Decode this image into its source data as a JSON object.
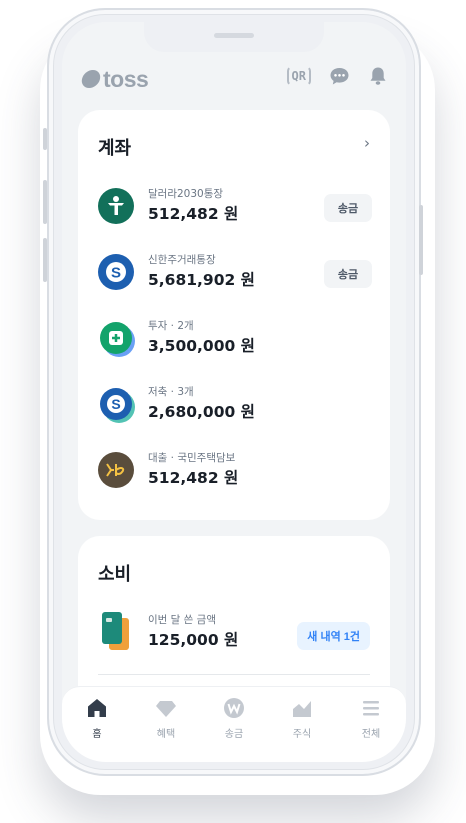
{
  "brand": {
    "name": "toss"
  },
  "header": {
    "qr_label": "QR",
    "icons": [
      "qr-code-icon",
      "chat-bubble-icon",
      "bell-icon"
    ]
  },
  "accounts": {
    "title": "계좌",
    "items": [
      {
        "label": "달러라2030통장",
        "amount": "512,482 원",
        "action": "송금",
        "icon": "bank-person-icon",
        "color": "#12705a"
      },
      {
        "label": "신한주거래통장",
        "amount": "5,681,902 원",
        "action": "송금",
        "icon": "shinhan-s-icon",
        "color": "#1d5fb0"
      },
      {
        "label": "투자 · 2개",
        "amount": "3,500,000 원",
        "action": "",
        "icon": "investment-stack-icon",
        "color": "#13a36b"
      },
      {
        "label": "저축 · 3개",
        "amount": "2,680,000 원",
        "action": "",
        "icon": "savings-stack-icon",
        "color": "#1d5fb0"
      },
      {
        "label": "대출 · 국민주택담보",
        "amount": "512,482 원",
        "action": "",
        "icon": "kb-loan-icon",
        "color": "#5a4d3c"
      }
    ]
  },
  "spending": {
    "title": "소비",
    "label": "이번 달 쓴 금액",
    "amount": "125,000 원",
    "action": "새 내역 1건",
    "icon": "cards-icon"
  },
  "tabs": [
    {
      "label": "홈",
      "icon": "home-icon",
      "active": true
    },
    {
      "label": "혜택",
      "icon": "gem-icon",
      "active": false
    },
    {
      "label": "송금",
      "icon": "won-coin-icon",
      "active": false
    },
    {
      "label": "주식",
      "icon": "stock-chart-icon",
      "active": false
    },
    {
      "label": "전체",
      "icon": "menu-lines-icon",
      "active": false
    }
  ],
  "colors": {
    "background": "#f2f4f6",
    "card": "#ffffff",
    "text_primary": "#191f28",
    "text_secondary": "#6b7684",
    "accent": "#3182f6",
    "accent_bg": "#e8f3ff",
    "muted_icon": "#9aa3ae"
  }
}
